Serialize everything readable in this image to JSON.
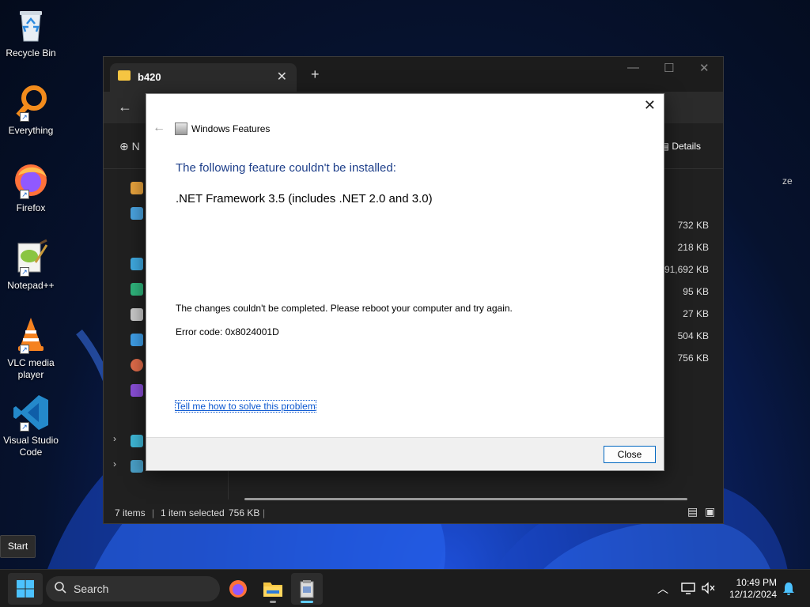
{
  "desktop": {
    "icons": [
      {
        "label": "Recycle Bin",
        "icon": "recycle-bin-icon"
      },
      {
        "label": "Everything",
        "icon": "everything-search-icon"
      },
      {
        "label": "Firefox",
        "icon": "firefox-icon"
      },
      {
        "label": "Notepad++",
        "icon": "notepad-plus-plus-icon"
      },
      {
        "label": "VLC media player",
        "icon": "vlc-icon"
      },
      {
        "label": "Visual Studio Code",
        "icon": "vscode-icon"
      }
    ]
  },
  "explorer": {
    "tab_title": "b420",
    "new_label": "N",
    "details_label": "Details",
    "column_header": "ze",
    "sizes": [
      "732 KB",
      "218 KB",
      "91,692 KB",
      "95 KB",
      "27 KB",
      "504 KB",
      "756 KB"
    ],
    "status": {
      "items": "7 items",
      "selected": "1 item selected",
      "size": "756 KB"
    }
  },
  "dialog": {
    "title": "Windows Features",
    "heading": "The following feature couldn't be installed:",
    "feature": ".NET Framework 3.5 (includes .NET 2.0 and 3.0)",
    "message": "The changes couldn't be completed. Please reboot your computer and try again.",
    "error": "Error code: 0x8024001D",
    "link": "Tell me how to solve this problem",
    "close_button": "Close"
  },
  "tooltip": "Start",
  "taskbar": {
    "search_placeholder": "Search",
    "time": "10:49 PM",
    "date": "12/12/2024",
    "accent": "#60cdff"
  }
}
